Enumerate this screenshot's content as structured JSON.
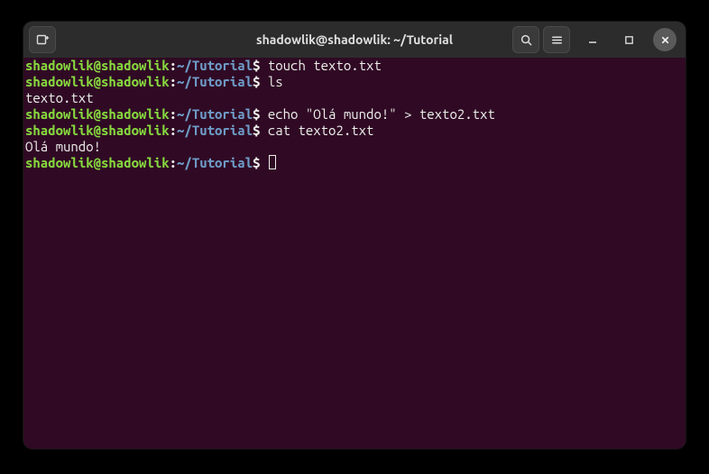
{
  "window": {
    "title": "shadowlik@shadowlik: ~/Tutorial"
  },
  "prompt": {
    "user": "shadowlik@shadowlik",
    "colon": ":",
    "path": "~/Tutorial",
    "dollar": "$"
  },
  "lines": {
    "l0_cmd": " touch texto.txt",
    "l1_cmd": " ls",
    "l2_out": "texto.txt",
    "l3_cmd": " echo \"Olá mundo!\" > texto2.txt",
    "l4_cmd": " cat texto2.txt",
    "l5_out": "Olá mundo!",
    "l6_cmd": " "
  },
  "icons": {
    "new_tab": "new-tab-icon",
    "search": "search-icon",
    "menu": "hamburger-menu-icon",
    "minimize": "minimize-icon",
    "maximize": "maximize-icon",
    "close": "close-icon"
  }
}
